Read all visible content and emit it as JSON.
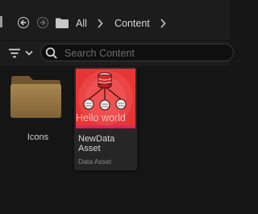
{
  "nav": {
    "back_icon": "back-arrow-icon",
    "forward_icon": "forward-arrow-icon",
    "folder_icon": "folder-icon",
    "breadcrumbs": [
      "All",
      "Content"
    ]
  },
  "filter": {
    "filter_icon": "filter-icon",
    "search_placeholder": "Search Content"
  },
  "assets": {
    "folder": {
      "label": "Icons"
    },
    "data_asset": {
      "name_line1": "NewData",
      "name_line2": "Asset",
      "type": "Data Asset",
      "thumbnail_text": "Hello world",
      "accent_color": "#d8245a",
      "thumb_color": "#e83535"
    }
  }
}
